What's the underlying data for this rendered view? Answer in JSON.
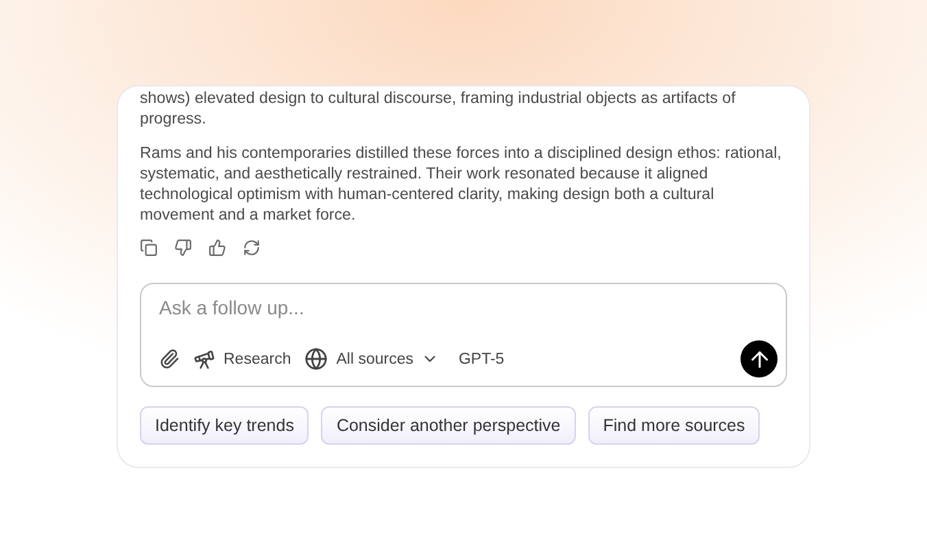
{
  "answer": {
    "paragraphs": [
      "shows) elevated design to cultural discourse, framing industrial objects as artifacts of progress.",
      "Rams and his contemporaries distilled these forces into a disciplined design ethos: rational, systematic, and aesthetically restrained. Their work resonated because it aligned technological optimism with human-centered clarity, making design both a cultural movement and a market force."
    ]
  },
  "composer": {
    "placeholder": "Ask a follow up...",
    "research_label": "Research",
    "sources_label": "All sources",
    "model_label": "GPT-5"
  },
  "suggestions": [
    "Identify key trends",
    "Consider another perspective",
    "Find more sources"
  ]
}
